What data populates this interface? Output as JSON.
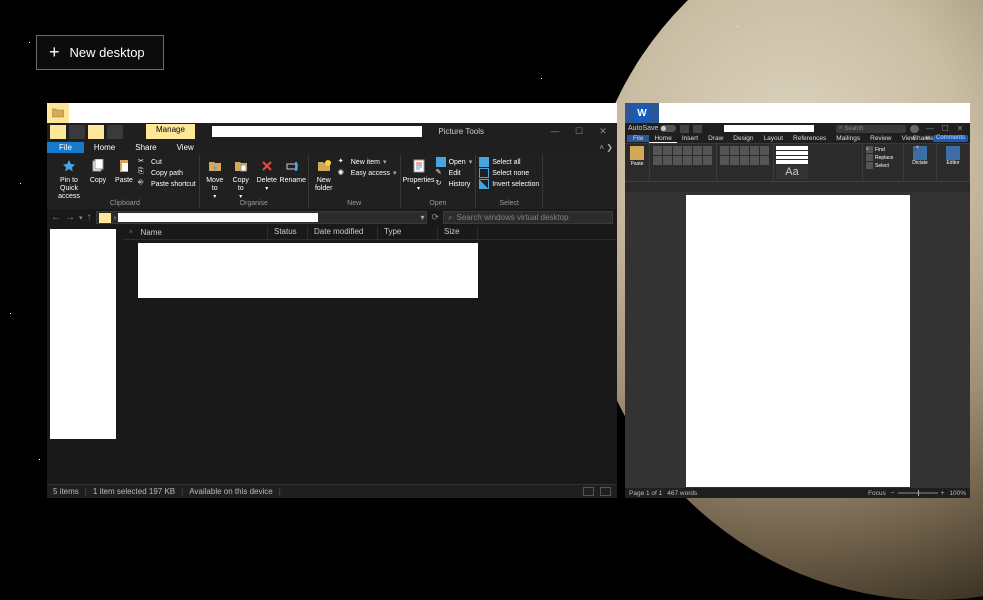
{
  "taskview": {
    "new_desktop_label": "New desktop"
  },
  "explorer": {
    "tabs_manage": "Manage",
    "tabs_picture": "Picture Tools",
    "menu": {
      "file": "File",
      "home": "Home",
      "share": "Share",
      "view": "View"
    },
    "ribbon": {
      "pin": "Pin to Quick access",
      "copy": "Copy",
      "paste": "Paste",
      "cut": "Cut",
      "copy_path": "Copy path",
      "paste_shortcut": "Paste shortcut",
      "clipboard_label": "Clipboard",
      "move_to": "Move to",
      "copy_to": "Copy to",
      "delete": "Delete",
      "rename": "Rename",
      "organise_label": "Organise",
      "new_folder": "New folder",
      "new_item": "New item",
      "easy_access": "Easy access",
      "new_label": "New",
      "properties": "Properties",
      "open": "Open",
      "edit": "Edit",
      "history": "History",
      "open_label": "Open",
      "select_all": "Select all",
      "select_none": "Select none",
      "invert": "Invert selection",
      "select_label": "Select"
    },
    "search_placeholder": "Search windows virtual desktop",
    "columns": {
      "name": "Name",
      "status": "Status",
      "date": "Date modified",
      "type": "Type",
      "size": "Size"
    },
    "status": {
      "items": "5 items",
      "selected": "1 item selected  197 KB",
      "available": "Available on this device"
    }
  },
  "word": {
    "autosave": "AutoSave",
    "search": "Search",
    "menu": {
      "file": "File",
      "home": "Home",
      "insert": "Insert",
      "draw": "Draw",
      "design": "Design",
      "layout": "Layout",
      "references": "References",
      "mailings": "Mailings",
      "review": "Review",
      "view": "View",
      "help": "Help"
    },
    "share": "Share",
    "comments": "Comments",
    "paste": "Paste",
    "styles_aa": "Aa",
    "find": "Find",
    "replace": "Replace",
    "select": "Select",
    "dictate": "Dictate",
    "editor": "Editor",
    "status": {
      "page": "Page 1 of 1",
      "words": "467 words",
      "focus": "Focus",
      "zoom": "100%"
    }
  }
}
